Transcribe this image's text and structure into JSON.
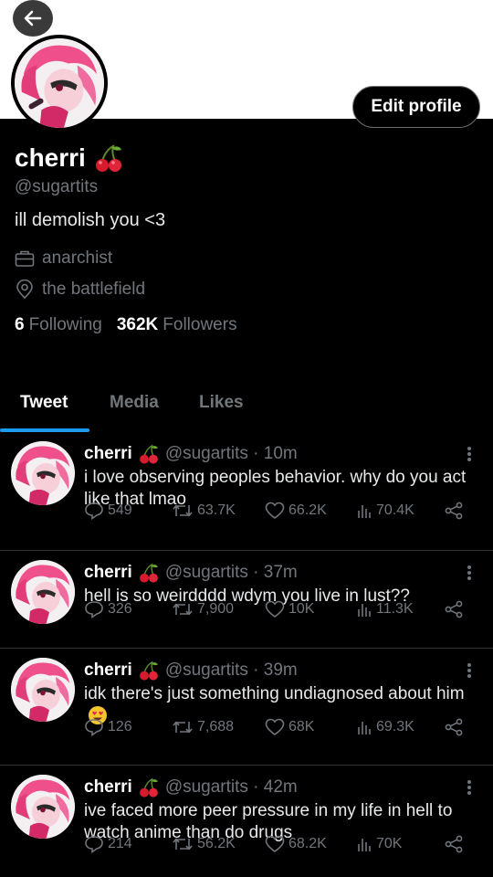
{
  "profile": {
    "name": "cherri",
    "handle": "@sugartits",
    "bio": "ill demolish you <3",
    "work": "anarchist",
    "location": "the battlefield",
    "following_count": "6",
    "following_label": "Following",
    "followers_count": "362K",
    "followers_label": "Followers",
    "edit_label": "Edit profile"
  },
  "tabs": [
    {
      "label": "Tweet",
      "active": true
    },
    {
      "label": "Media",
      "active": false
    },
    {
      "label": "Likes",
      "active": false
    }
  ],
  "tweets": [
    {
      "name": "cherri",
      "handle": "@sugartits · 10m",
      "text": "i love observing peoples behavior. why do you act like that lmao",
      "replies": "549",
      "retweets": "63.7K",
      "likes": "66.2K",
      "views": "70.4K"
    },
    {
      "name": "cherri",
      "handle": "@sugartits · 37m",
      "text": "hell is so weirdddd wdym you live in lust??",
      "replies": "326",
      "retweets": "7,900",
      "likes": "10K",
      "views": "11.3K"
    },
    {
      "name": "cherri",
      "handle": "@sugartits · 39m",
      "text": "idk there's just something undiagnosed about him",
      "replies": "126",
      "retweets": "7,688",
      "likes": "68K",
      "views": "69.3K"
    },
    {
      "name": "cherri",
      "handle": "@sugartits · 42m",
      "text": "ive faced more peer pressure in my life in hell to watch anime than do drugs",
      "replies": "214",
      "retweets": "56.2K",
      "likes": "68.2K",
      "views": "70K"
    }
  ],
  "icons": {
    "back": "arrow-left-icon",
    "cherry": "cherry-emoji-icon",
    "briefcase": "briefcase-icon",
    "location": "location-pin-icon",
    "reply": "reply-icon",
    "retweet": "retweet-icon",
    "like": "heart-icon",
    "views": "views-icon",
    "share": "share-icon",
    "heart_eyes": "heart-eyes-emoji-icon"
  },
  "colors": {
    "background": "#000000",
    "accent": "#1d9bf0",
    "muted": "#71767b",
    "avatar_pink": "#e8457f"
  }
}
